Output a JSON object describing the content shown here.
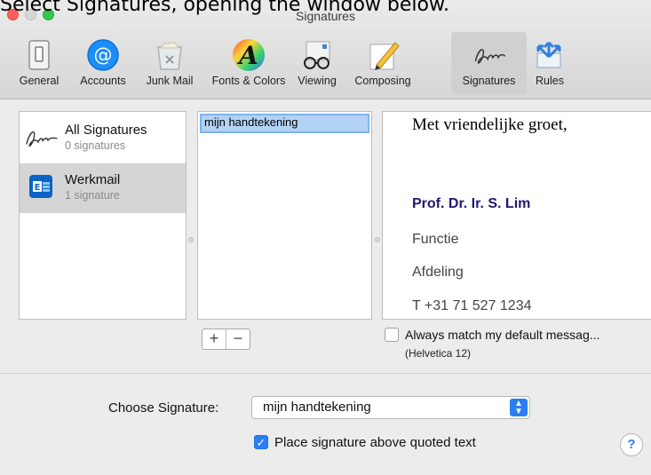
{
  "caption": "Select Signatures, opening the window below.",
  "window": {
    "title": "Signatures"
  },
  "toolbar": {
    "items": [
      {
        "label": "General",
        "icon": "switch-icon"
      },
      {
        "label": "Accounts",
        "icon": "at-icon"
      },
      {
        "label": "Junk Mail",
        "icon": "trash-icon"
      },
      {
        "label": "Fonts & Colors",
        "icon": "font-icon"
      },
      {
        "label": "Viewing",
        "icon": "glasses-icon"
      },
      {
        "label": "Composing",
        "icon": "pencil-icon"
      },
      {
        "label": "Signatures",
        "icon": "signature-icon",
        "selected": true
      },
      {
        "label": "Rules",
        "icon": "arrows-icon"
      }
    ]
  },
  "accounts": [
    {
      "title": "All Signatures",
      "subtitle": "0 signatures"
    },
    {
      "title": "Werkmail",
      "subtitle": "1 signature",
      "selected": true
    }
  ],
  "signatures": {
    "selected_name": "mijn handtekening"
  },
  "preview": {
    "greeting": "Met vriendelijke groet,",
    "name": "Prof. Dr. Ir. S. Lim",
    "function": "Functie",
    "department": "Afdeling",
    "phone": "T +31 71 527 1234"
  },
  "controls": {
    "plus": "+",
    "minus": "−",
    "match_font_label": "Always match my default messag...",
    "match_font_sub": "(Helvetica 12)",
    "choose_label": "Choose Signature:",
    "choose_value": "mijn handtekening",
    "place_above_label": "Place signature above quoted text",
    "help": "?"
  },
  "colors": {
    "accent": "#2b7ef4",
    "name_color": "#1f1a6e"
  }
}
